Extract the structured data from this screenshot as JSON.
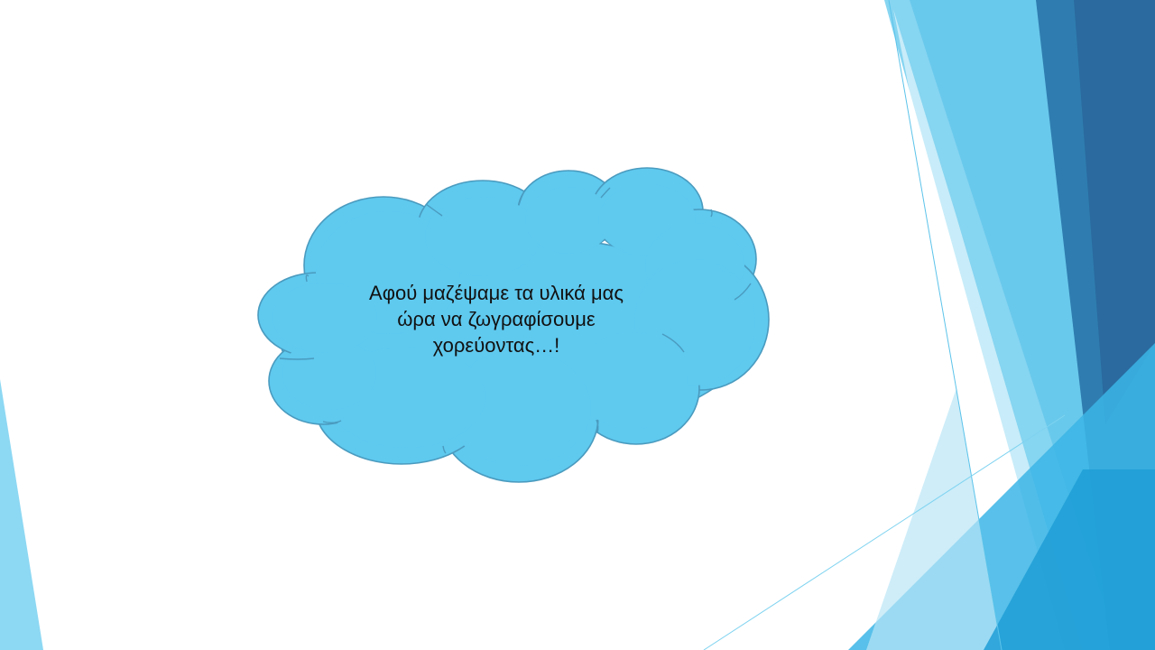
{
  "slide": {
    "cloud_text_lines": [
      "Αφού μαζέψαμε τα υλικά μας",
      "ώρα να ζωγραφίσουμε",
      "χορεύοντας…!"
    ]
  },
  "colors": {
    "background": "#ffffff",
    "cloud_fill": "#5fc9ee",
    "cloud_stroke": "#4a9bbf",
    "accent_light": "#7fd3f0",
    "accent_mid": "#29a8df",
    "accent_dark": "#2d6fa3"
  },
  "icons": {
    "cloud": "thought-cloud-shape",
    "decoration": "blue-triangle-facets"
  }
}
